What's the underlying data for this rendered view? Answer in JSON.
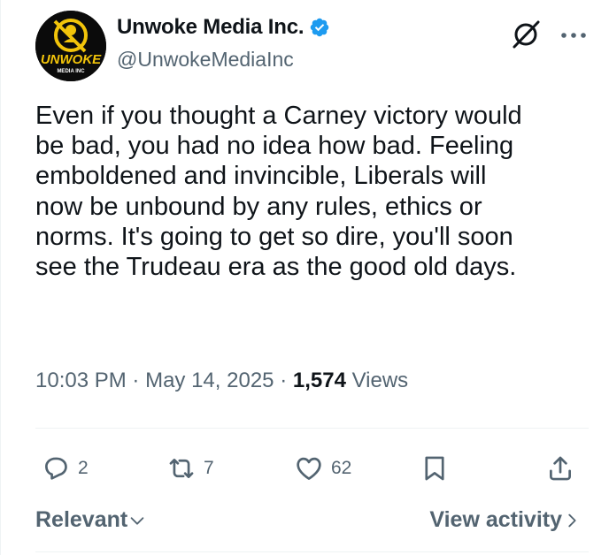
{
  "account": {
    "display_name": "Unwoke Media Inc.",
    "handle": "@UnwokeMediaInc",
    "avatar_text": "UNWOKE",
    "avatar_subtext": "MEDIA INC",
    "verified_color": "#1d9bf0"
  },
  "tweet": {
    "text": "Even if you thought a Carney victory would\nbe bad, you had no idea how bad. Feeling\nemboldened and invincible, Liberals will\nnow be unbound by any rules, ethics or\nnorms. It's going to get so dire, you'll soon\nsee the Trudeau era as the good old days.",
    "time": "10:03 PM",
    "date": "May 14, 2025",
    "separator": "·",
    "views_count": "1,574",
    "views_label": "Views"
  },
  "actions": {
    "replies": "2",
    "reposts": "7",
    "likes": "62"
  },
  "footer": {
    "sort_label": "Relevant",
    "activity_label": "View activity"
  },
  "icons": {
    "grok": "grok-icon",
    "more": "more-icon",
    "reply": "reply-icon",
    "repost": "repost-icon",
    "like": "heart-icon",
    "bookmark": "bookmark-icon",
    "share": "share-icon"
  }
}
